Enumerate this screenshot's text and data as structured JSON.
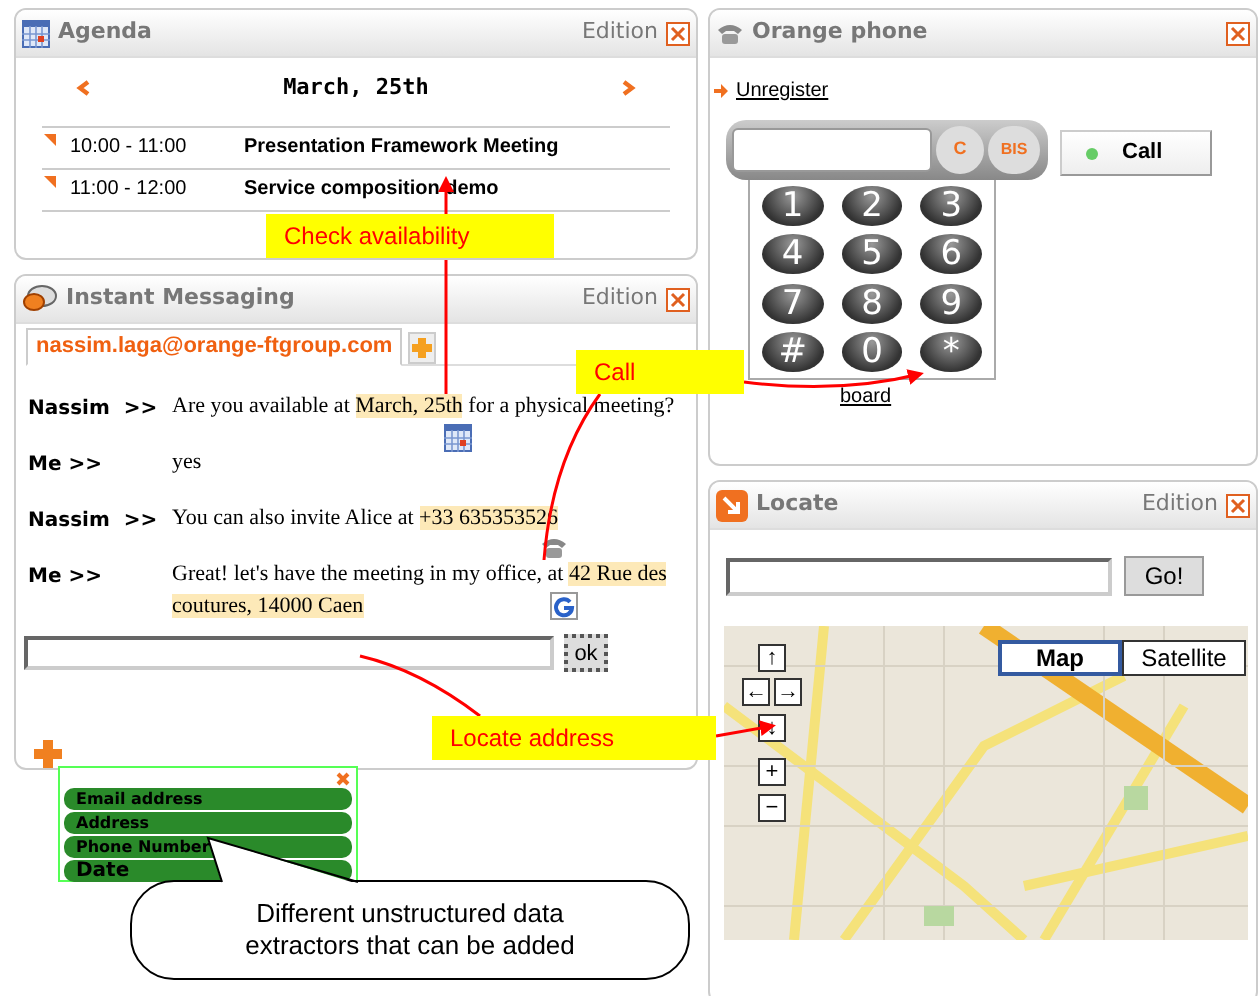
{
  "agenda": {
    "title": "Agenda",
    "edition": "Edition",
    "date": "March, 25th",
    "events": [
      {
        "time": "10:00 - 11:00",
        "title": "Presentation Framework Meeting"
      },
      {
        "time": "11:00 - 12:00",
        "title": "Service composition demo"
      }
    ]
  },
  "messaging": {
    "title": "Instant Messaging",
    "edition": "Edition",
    "tab": "nassim.laga@orange-ftgroup.com",
    "messages": [
      {
        "sender": "Nassim  >>",
        "parts": [
          {
            "text": "Are you available at "
          },
          {
            "text": "March, 25th",
            "kind": "date"
          },
          {
            "text": " for a physical meeting?"
          }
        ]
      },
      {
        "sender": "Me >>",
        "parts": [
          {
            "text": "yes"
          }
        ]
      },
      {
        "sender": "Nassim  >>",
        "parts": [
          {
            "text": "You can also invite Alice at "
          },
          {
            "text": "+33 635353526",
            "kind": "phone"
          }
        ]
      },
      {
        "sender": "Me >>",
        "parts": [
          {
            "text": "Great! let's have the meeting in my office, at "
          },
          {
            "text": "42 Rue des coutures, 14000 Caen",
            "kind": "address"
          }
        ]
      }
    ],
    "send_button": "ok"
  },
  "extractors": {
    "items": [
      "Email address",
      "Address",
      "Phone Number",
      "Date"
    ]
  },
  "callout": "Different unstructured data extractors that can be added",
  "phone": {
    "title": "Orange phone",
    "unregister": "Unregister",
    "clear_button": "C",
    "redial_button": "BIS",
    "call_button": "Call",
    "keys": [
      "1",
      "2",
      "3",
      "4",
      "5",
      "6",
      "7",
      "8",
      "9",
      "#",
      "0",
      "*"
    ],
    "keypad_link": "board"
  },
  "locate": {
    "title": "Locate",
    "edition": "Edition",
    "go_button": "Go!",
    "map_nav": [
      "↑",
      "←",
      "→",
      "↓",
      "+",
      "−"
    ],
    "map_types": [
      {
        "label": "Map",
        "selected": true
      },
      {
        "label": "Satellite",
        "selected": false
      }
    ]
  },
  "annotations": [
    "Check availability",
    "Call",
    "Locate address"
  ]
}
